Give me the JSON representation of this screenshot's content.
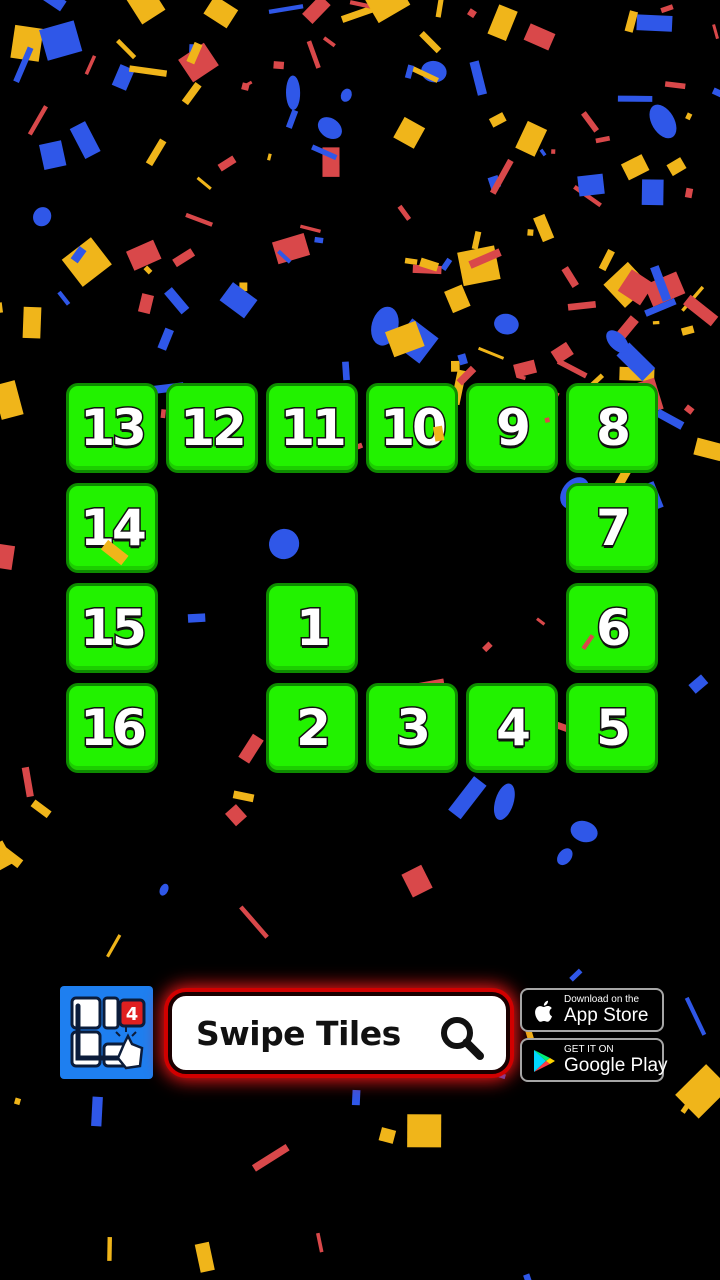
{
  "game": {
    "tiles": [
      "13",
      "12",
      "11",
      "10",
      "9",
      "8",
      "14",
      "7",
      "15",
      "1",
      "6",
      "16",
      "2",
      "3",
      "4",
      "5"
    ]
  },
  "search": {
    "label": "Swipe Tiles",
    "icon": "magnifier-icon"
  },
  "stores": {
    "appstore_small": "Download on the",
    "appstore_big": "App Store",
    "googleplay_small": "GET IT ON",
    "googleplay_big": "Google Play"
  },
  "icons": {
    "app": "app-icon",
    "apple": "apple-icon",
    "play": "play-icon"
  },
  "colors": {
    "tile": "#22f200",
    "tile_border": "#0e8c00",
    "confetti_blue": "#2f57e8",
    "confetti_red": "#d9484a",
    "confetti_yellow": "#f0b51a",
    "search_glow": "#ff1a1a",
    "app_icon_bg": "#1e7ff0"
  }
}
